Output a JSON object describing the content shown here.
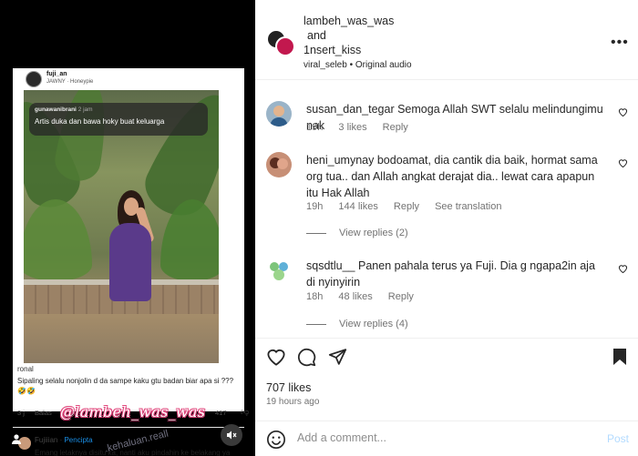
{
  "media": {
    "card": {
      "username": "fuji_an",
      "song": "JAWNY · Honeypie",
      "photo_comment_user": "gunawanibrani",
      "photo_comment_time": "2 jam",
      "photo_comment_text": "Artis duka dan bawa hoky buat keluarga"
    },
    "overlay": {
      "comment1_user": "ronal",
      "comment1_text": "Sipaling selalu nonjolin d  da sampe kaku gtu badan biar apa si ??? 🤣🤣",
      "comment1_time": "3 j",
      "comment1_reply": "Balas",
      "comment1_count": "417",
      "watermark": "@lambeh_was_was",
      "watermark_faint": ".kehaluan.reall",
      "comment2_user": "Fujiiian",
      "comment2_badge": "Pencipta",
      "comment2_text": "Emang letaknya disitu ka, nanti aku pindahin ke belakang ya"
    }
  },
  "header": {
    "author1": "lambeh_was_was",
    "and": "and",
    "author2": "1nsert_kiss",
    "audio_owner": "viral_seleb",
    "audio_label": "Original audio"
  },
  "comments": [
    {
      "user": "susan_dan_tegar",
      "text": "Semoga Allah SWT selalu melindungimu nak",
      "time": "19h",
      "likes": "3 likes",
      "reply": "Reply",
      "translate": ""
    },
    {
      "user": "heni_umynay",
      "text": "bodoamat, dia cantik dia baik, hormat sama org tua.. dan Allah angkat derajat dia.. lewat cara apapun itu Hak Allah",
      "time": "19h",
      "likes": "144 likes",
      "reply": "Reply",
      "translate": "See translation",
      "view_replies": "View replies (2)"
    },
    {
      "user": "sqsdtlu__",
      "text": "Panen pahala terus ya Fuji. Dia g ngapa2in aja di nyinyirin",
      "time": "18h",
      "likes": "48 likes",
      "reply": "Reply",
      "translate": "",
      "view_replies": "View replies (4)"
    }
  ],
  "footer": {
    "likes": "707 likes",
    "ago": "19 hours ago",
    "add_comment_placeholder": "Add a comment...",
    "post_label": "Post"
  },
  "colors": {
    "muted_text": "#737373",
    "post_button_disabled": "#b3dbff",
    "verified_blue": "#1a8fe6"
  }
}
